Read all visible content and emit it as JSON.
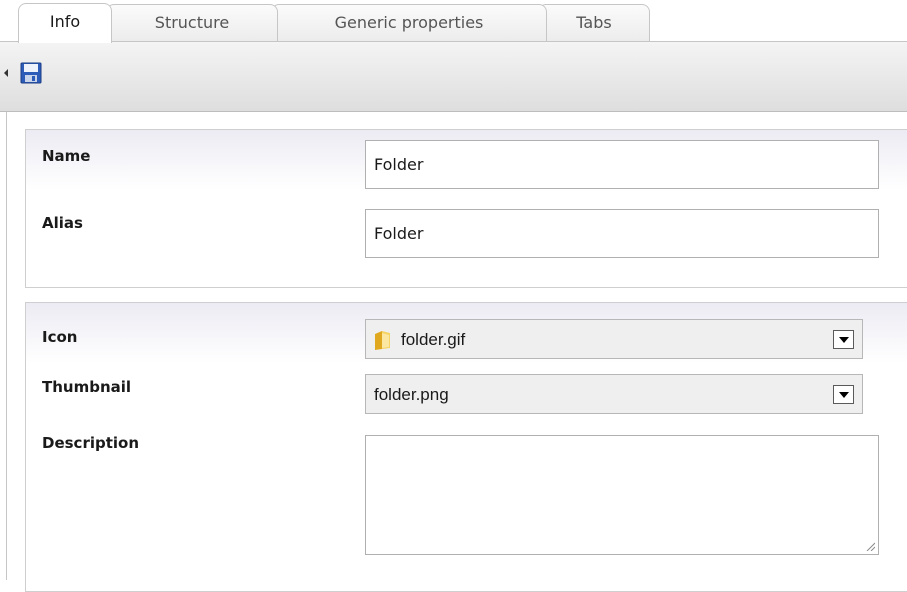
{
  "tabs": [
    {
      "label": "Info",
      "active": true
    },
    {
      "label": "Structure",
      "active": false
    },
    {
      "label": "Generic properties",
      "active": false
    },
    {
      "label": "Tabs",
      "active": false
    }
  ],
  "toolbar": {
    "save_icon": "save-icon"
  },
  "general": {
    "name_label": "Name",
    "name_value": "Folder",
    "alias_label": "Alias",
    "alias_value": "Folder"
  },
  "appearance": {
    "icon_label": "Icon",
    "icon_value": "folder.gif",
    "icon_glyph": "folder-icon",
    "thumbnail_label": "Thumbnail",
    "thumbnail_value": "folder.png",
    "description_label": "Description",
    "description_value": ""
  },
  "colors": {
    "tab_border": "#c6c6c6",
    "toolbar_top": "#f4f4f4",
    "toolbar_bottom": "#dedede",
    "panel_tint": "#ecebf3",
    "save_icon_blue": "#2d5bb8"
  }
}
